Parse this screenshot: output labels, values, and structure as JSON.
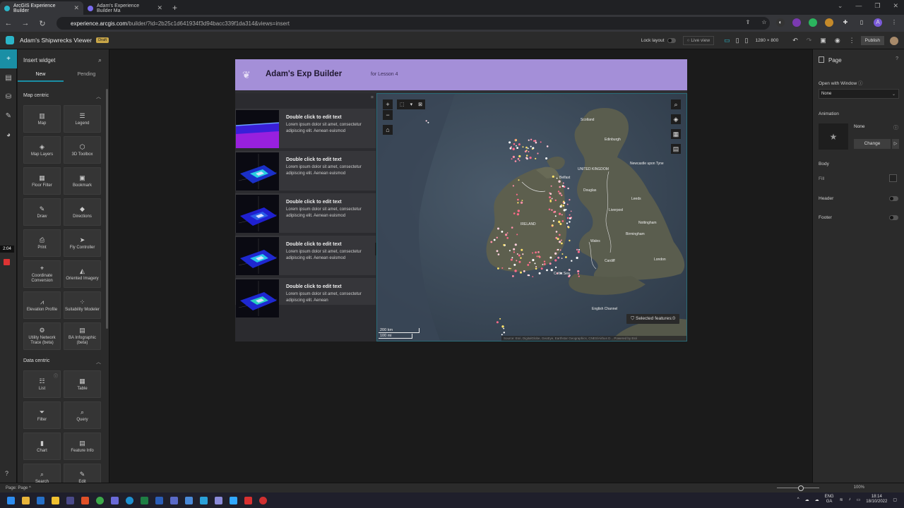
{
  "browser": {
    "tabs": [
      {
        "label": "ArcGIS Experience Builder",
        "active": true
      },
      {
        "label": "Adam's Experience Builder Ma",
        "active": false
      }
    ],
    "url_host": "experience.arcgis.com",
    "url_path": "/builder/?id=2b25c1d641934f3d94bacc339f1da314&views=insert"
  },
  "app": {
    "name": "Adam's Shipwrecks Viewer",
    "badge": "Draft",
    "lock_layout_label": "Lock layout",
    "live_view_label": "Live view",
    "resolution": "1280 × 800",
    "publish_label": "Publish"
  },
  "rail": {
    "timer": "2:04"
  },
  "widget_panel": {
    "title": "Insert widget",
    "tabs": [
      "New",
      "Pending"
    ],
    "map_section": "Map centric",
    "map_widgets": [
      {
        "label": "Map",
        "icon": "▥"
      },
      {
        "label": "Legend",
        "icon": "☰"
      },
      {
        "label": "Map Layers",
        "icon": "◈"
      },
      {
        "label": "3D Toolbox",
        "icon": "⬡"
      },
      {
        "label": "Floor Filter",
        "icon": "▦"
      },
      {
        "label": "Bookmark",
        "icon": "▣"
      },
      {
        "label": "Draw",
        "icon": "✎"
      },
      {
        "label": "Directions",
        "icon": "◆"
      },
      {
        "label": "Print",
        "icon": "⎙"
      },
      {
        "label": "Fly Controller",
        "icon": "➤"
      },
      {
        "label": "Coordinate Conversion",
        "icon": "⌖"
      },
      {
        "label": "Oriented Imagery",
        "icon": "◭"
      },
      {
        "label": "Elevation Profile",
        "icon": "⩘"
      },
      {
        "label": "Suitability Modeler",
        "icon": "⁘"
      },
      {
        "label": "Utility Network Trace (beta)",
        "icon": "⚙"
      },
      {
        "label": "BA Infographic (beta)",
        "icon": "▤"
      }
    ],
    "data_section": "Data centric",
    "data_widgets": [
      {
        "label": "List",
        "icon": "☷"
      },
      {
        "label": "Table",
        "icon": "▦"
      },
      {
        "label": "Filter",
        "icon": "⏷"
      },
      {
        "label": "Query",
        "icon": "⌕"
      },
      {
        "label": "Chart",
        "icon": "▮"
      },
      {
        "label": "Feature Info",
        "icon": "▤"
      },
      {
        "label": "Search",
        "icon": "⌕"
      },
      {
        "label": "Edit",
        "icon": "✎"
      }
    ]
  },
  "page": {
    "banner_title": "Adam's Exp Builder",
    "banner_subtitle": "for Lesson 4",
    "list_items": [
      {
        "title": "Double click to edit text",
        "body": "Lorem ipsum dolor sit amet, consectetur adipiscing elit. Aenean euismod"
      },
      {
        "title": "Double click to edit text",
        "body": "Lorem ipsum dolor sit amet, consectetur adipiscing elit. Aenean euismod"
      },
      {
        "title": "Double click to edit text",
        "body": "Lorem ipsum dolor sit amet, consectetur adipiscing elit. Aenean euismod"
      },
      {
        "title": "Double click to edit text",
        "body": "Lorem ipsum dolor sit amet, consectetur adipiscing elit. Aenean euismod"
      },
      {
        "title": "Double click to edit text",
        "body": "Lorem ipsum dolor sit amet, consectetur adipiscing elit. Aenean"
      }
    ],
    "map": {
      "labels": [
        "Scotland",
        "Edinburgh",
        "UNITED KINGDOM",
        "Belfast",
        "Newcastle upon Tyne",
        "Douglas",
        "Leeds",
        "Liverpool",
        "IRELAND",
        "Nottingham",
        "Birmingham",
        "Wales",
        "Cardiff",
        "London",
        "Celtic Sea",
        "English Channel"
      ],
      "selected_features": "Selected features:0",
      "scale_km": "200 km",
      "scale_mi": "100 mi",
      "attribution": "Source: Esri, DigitalGlobe, GeoEye, Earthstar Geographics, CNES/Airbus D...",
      "powered_by": "Powered by Esri"
    }
  },
  "right_panel": {
    "title": "Page",
    "open_with_window_label": "Open with Window",
    "open_with_window_value": "None",
    "animation_label": "Animation",
    "animation_value": "None",
    "change_label": "Change",
    "body_label": "Body",
    "fill_label": "Fill",
    "header_label": "Header",
    "footer_label": "Footer"
  },
  "statusbar": {
    "page_label": "Page:",
    "page_value": "Page",
    "zoom": "100%"
  },
  "taskbar": {
    "lang": "ENG",
    "region": "GA",
    "time": "18:14",
    "date": "18/10/2022"
  }
}
